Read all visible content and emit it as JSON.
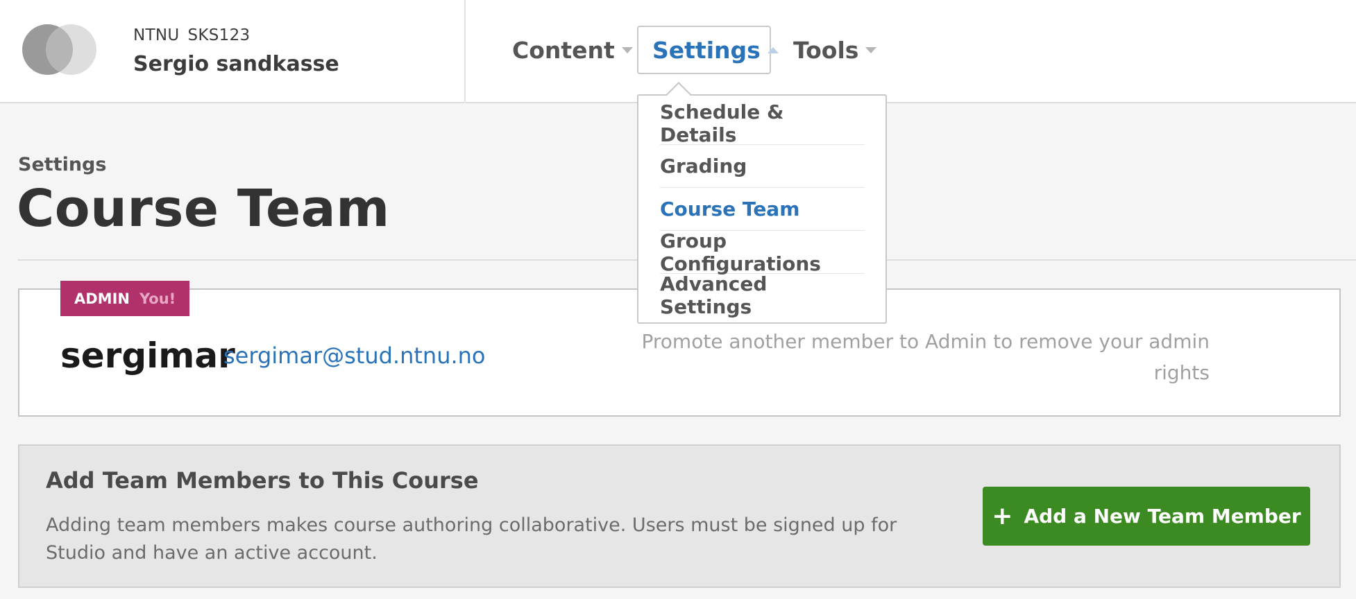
{
  "header": {
    "org": "NTNU",
    "course_number": "SKS123",
    "course_name": "Sergio sandkasse",
    "nav": {
      "content_label": "Content",
      "settings_label": "Settings",
      "tools_label": "Tools"
    }
  },
  "settings_menu": {
    "items": [
      {
        "label": "Schedule & Details",
        "active": false
      },
      {
        "label": "Grading",
        "active": false
      },
      {
        "label": "Course Team",
        "active": true
      },
      {
        "label": "Group Configurations",
        "active": false
      },
      {
        "label": "Advanced Settings",
        "active": false
      }
    ]
  },
  "page": {
    "subtitle": "Settings",
    "title": "Course Team"
  },
  "member": {
    "role_badge": "ADMIN",
    "you_label": "You!",
    "username": "sergimar",
    "email": "sergimar@stud.ntnu.no",
    "note": "Promote another member to Admin to remove your admin rights"
  },
  "add_panel": {
    "title": "Add Team Members to This Course",
    "description": "Adding team members makes course authoring collaborative. Users must be signed up for Studio and have an active account.",
    "button_label": "Add a New Team Member",
    "button_icon": "plus-icon"
  },
  "colors": {
    "accent_blue": "#2a73b8",
    "admin_badge": "#b1326b",
    "add_button": "#3b8a22"
  }
}
